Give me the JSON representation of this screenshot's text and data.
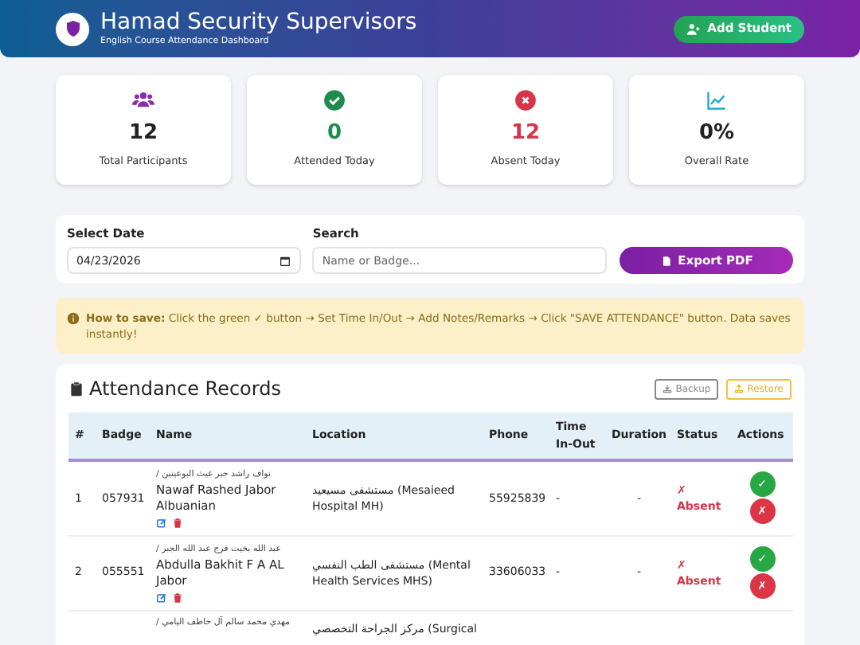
{
  "header": {
    "title": "Hamad Security Supervisors",
    "subtitle": "English Course Attendance Dashboard",
    "add_button": "Add Student"
  },
  "stats": [
    {
      "kind": "participants",
      "value": "12",
      "label": "Total Participants"
    },
    {
      "kind": "attended",
      "value": "0",
      "label": "Attended Today"
    },
    {
      "kind": "absent",
      "value": "12",
      "label": "Absent Today"
    },
    {
      "kind": "rate",
      "value": "0%",
      "label": "Overall Rate"
    }
  ],
  "filters": {
    "date_label": "Select Date",
    "date_value": "04/23/2026",
    "search_label": "Search",
    "search_placeholder": "Name or Badge...",
    "export_button": "Export PDF"
  },
  "notice": "**How to save:** Click the green ✓ button → Set Time In/Out → Add Notes/Remarks → Click \"SAVE ATTENDANCE\" button. Data saves instantly!",
  "records": {
    "title": "Attendance Records",
    "backup_button": "Backup",
    "restore_button": "Restore",
    "columns": [
      "#",
      "Badge",
      "Name",
      "Location",
      "Phone",
      "Time In-Out",
      "Duration",
      "Status",
      "Actions"
    ],
    "rows": [
      {
        "number": "1",
        "badge": "057931",
        "name_ar": "نواف راشد جبر غيث البوعينين /",
        "name": "Nawaf Rashed Jabor Albuanian",
        "location": "مستشفى مسيعيد (Mesaieed Hospital MH)",
        "phone": "55925839",
        "time": "-",
        "duration": "-",
        "status": "✗ Absent",
        "present": false,
        "present_button": "✓",
        "absent_button": "✗"
      },
      {
        "number": "2",
        "badge": "055551",
        "name_ar": "عبد الله بخيت فرج عبد الله الجبر /",
        "name": "Abdulla Bakhit F A AL Jabor",
        "location": "مستشفى الطب النفسي (Mental Health Services MHS)",
        "phone": "33606033",
        "time": "-",
        "duration": "-",
        "status": "✗ Absent",
        "present": false,
        "present_button": "✓",
        "absent_button": "✗"
      },
      {
        "name_ar": "مهدي محمد سالم آل حاطف اليامي /",
        "location": "مركز الجراحة التخصصي (Surgical"
      }
    ]
  }
}
